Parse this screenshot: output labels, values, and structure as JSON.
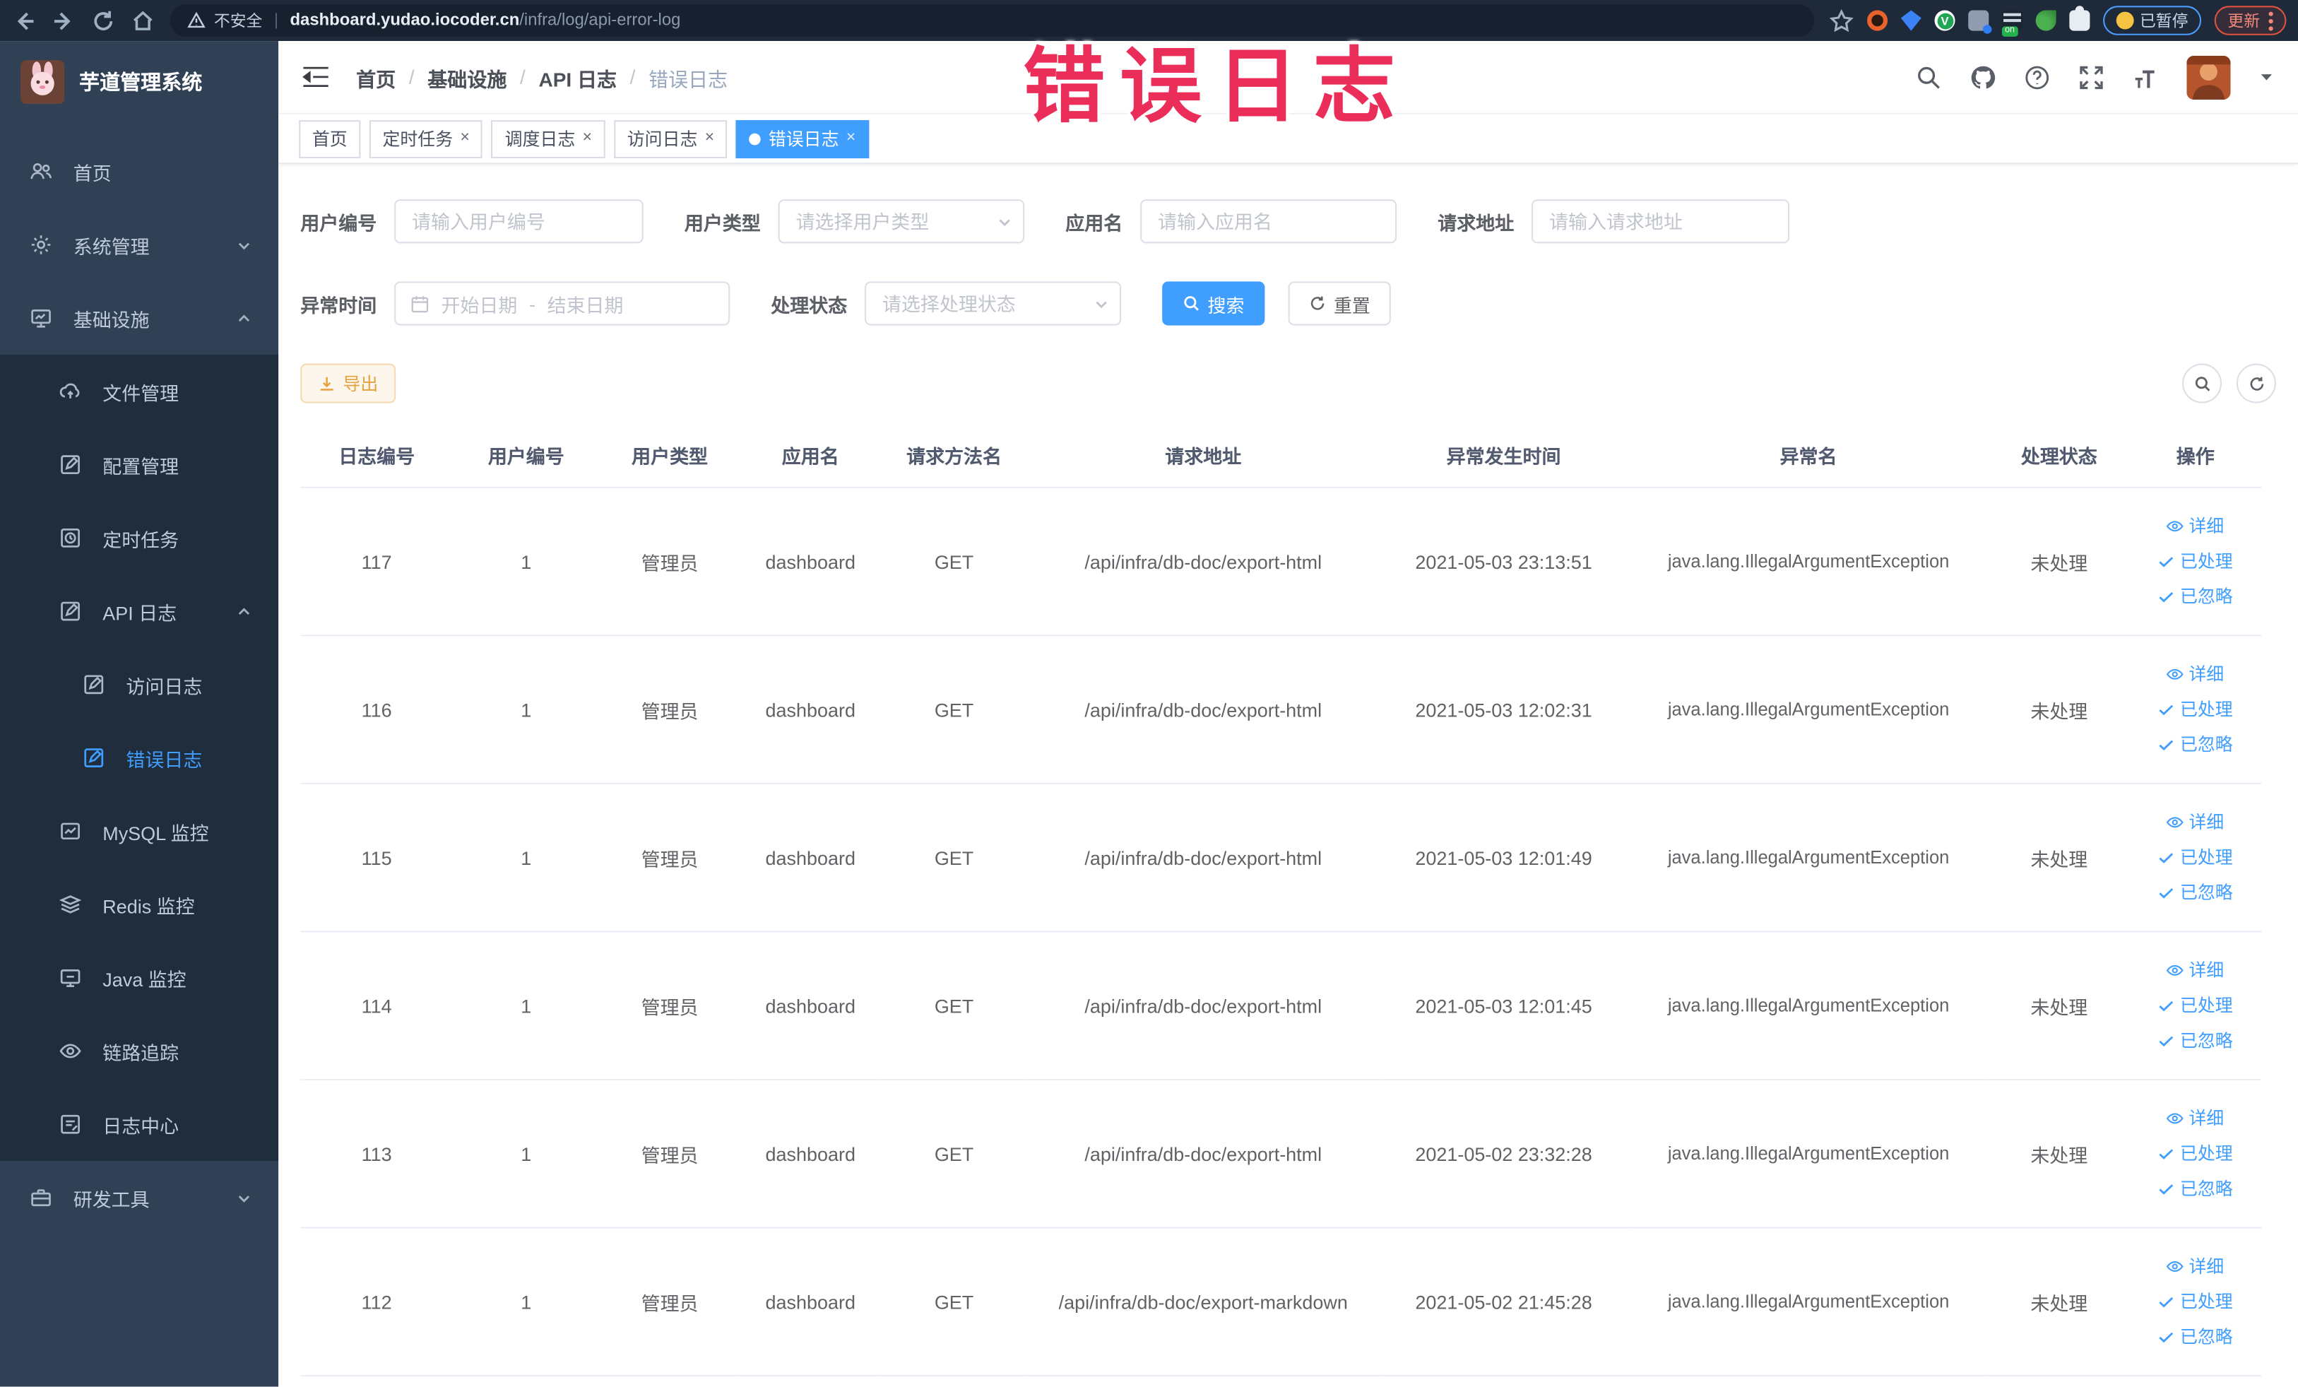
{
  "chrome": {
    "security_label": "不安全",
    "url_domain": "dashboard.yudao.iocoder.cn",
    "url_path": "/infra/log/api-error-log",
    "paused_pill": "已暂停",
    "update_pill": "更新"
  },
  "annotation": {
    "text": "错误日志",
    "color": "#eb2d5a"
  },
  "sidebar": {
    "title": "芋道管理系统",
    "menu": [
      {
        "label": "首页"
      },
      {
        "label": "系统管理"
      },
      {
        "label": "基础设施"
      },
      {
        "label": "文件管理"
      },
      {
        "label": "配置管理"
      },
      {
        "label": "定时任务"
      },
      {
        "label": "API 日志"
      },
      {
        "label": "访问日志"
      },
      {
        "label": "错误日志",
        "active": true
      },
      {
        "label": "MySQL 监控"
      },
      {
        "label": "Redis 监控"
      },
      {
        "label": "Java 监控"
      },
      {
        "label": "链路追踪"
      },
      {
        "label": "日志中心"
      },
      {
        "label": "研发工具"
      }
    ]
  },
  "navbar": {
    "breadcrumb": [
      "首页",
      "基础设施",
      "API 日志",
      "错误日志"
    ],
    "separator": "/"
  },
  "tags": [
    {
      "label": "首页"
    },
    {
      "label": "定时任务"
    },
    {
      "label": "调度日志"
    },
    {
      "label": "访问日志"
    },
    {
      "label": "错误日志",
      "active": true
    }
  ],
  "filters": {
    "user_id": {
      "label": "用户编号",
      "placeholder": "请输入用户编号"
    },
    "user_type": {
      "label": "用户类型",
      "placeholder": "请选择用户类型"
    },
    "app_name": {
      "label": "应用名",
      "placeholder": "请输入应用名"
    },
    "request_url": {
      "label": "请求地址",
      "placeholder": "请输入请求地址"
    },
    "exception_time": {
      "label": "异常时间",
      "start_placeholder": "开始日期",
      "separator": "-",
      "end_placeholder": "结束日期"
    },
    "process_status": {
      "label": "处理状态",
      "placeholder": "请选择处理状态"
    },
    "search_button": "搜索",
    "reset_button": "重置",
    "export_button": "导出"
  },
  "table": {
    "columns": [
      "日志编号",
      "用户编号",
      "用户类型",
      "应用名",
      "请求方法名",
      "请求地址",
      "异常发生时间",
      "异常名",
      "处理状态",
      "操作"
    ],
    "actions": [
      "详细",
      "已处理",
      "已忽略"
    ],
    "rows": [
      [
        "117",
        "1",
        "管理员",
        "dashboard",
        "GET",
        "/api/infra/db-doc/export-html",
        "2021-05-03 23:13:51",
        "java.lang.IllegalArgumentException",
        "未处理"
      ],
      [
        "116",
        "1",
        "管理员",
        "dashboard",
        "GET",
        "/api/infra/db-doc/export-html",
        "2021-05-03 12:02:31",
        "java.lang.IllegalArgumentException",
        "未处理"
      ],
      [
        "115",
        "1",
        "管理员",
        "dashboard",
        "GET",
        "/api/infra/db-doc/export-html",
        "2021-05-03 12:01:49",
        "java.lang.IllegalArgumentException",
        "未处理"
      ],
      [
        "114",
        "1",
        "管理员",
        "dashboard",
        "GET",
        "/api/infra/db-doc/export-html",
        "2021-05-03 12:01:45",
        "java.lang.IllegalArgumentException",
        "未处理"
      ],
      [
        "113",
        "1",
        "管理员",
        "dashboard",
        "GET",
        "/api/infra/db-doc/export-html",
        "2021-05-02 23:32:28",
        "java.lang.IllegalArgumentException",
        "未处理"
      ],
      [
        "112",
        "1",
        "管理员",
        "dashboard",
        "GET",
        "/api/infra/db-doc/export-markdown",
        "2021-05-02 21:45:28",
        "java.lang.IllegalArgumentException",
        "未处理"
      ]
    ]
  },
  "colors": {
    "accent": "#409eff",
    "warning": "#e6a23c",
    "sidebar_bg": "#304156",
    "submenu_bg": "#1f2d3d"
  }
}
